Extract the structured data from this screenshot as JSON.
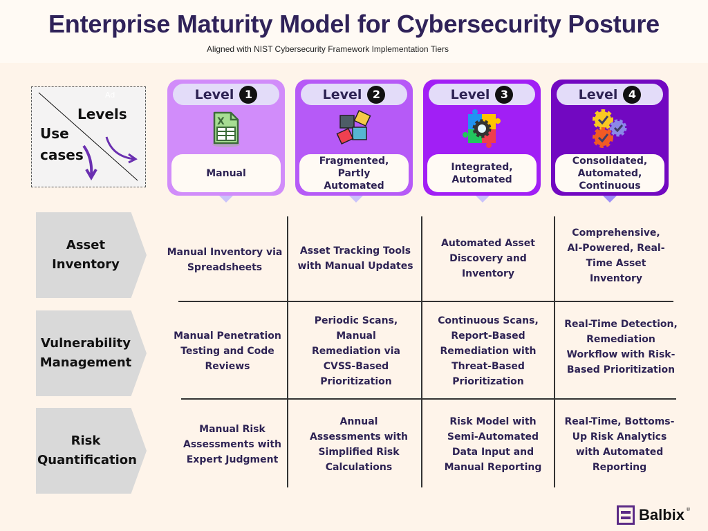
{
  "header": {
    "title": "Enterprise Maturity Model for Cybersecurity Posture",
    "subtitle": "Aligned with NIST Cybersecurity Framework Implementation Tiers"
  },
  "legend": {
    "levels_label": "Levels",
    "use_cases_line1": "Use",
    "use_cases_line2": "cases",
    "watermark": "Ad"
  },
  "levels": [
    {
      "word": "Level",
      "number": "1",
      "description": "Manual",
      "icon": "spreadsheet-icon",
      "color": "#d18cfa"
    },
    {
      "word": "Level",
      "number": "2",
      "description": "Fragmented, Partly Automated",
      "icon": "puzzle-pieces-icon",
      "color": "#b65af7"
    },
    {
      "word": "Level",
      "number": "3",
      "description": "Integrated, Automated",
      "icon": "puzzle-gear-icon",
      "color": "#a11ff5"
    },
    {
      "word": "Level",
      "number": "4",
      "description": "Consolidated, Automated, Continuous",
      "icon": "gears-check-icon",
      "color": "#7208c1"
    }
  ],
  "rows": [
    {
      "use_case": "Asset Inventory",
      "cells": [
        "Manual Inventory via Spreadsheets",
        "Asset Tracking Tools with Manual Updates",
        "Automated Asset Discovery and Inventory",
        "Comprehensive, AI-Powered, Real-Time Asset Inventory"
      ]
    },
    {
      "use_case": "Vulnerability Management",
      "cells": [
        "Manual Penetration Testing and Code Reviews",
        "Periodic Scans, Manual Remediation via CVSS-Based Prioritization",
        "Continuous Scans, Report-Based Remediation with Threat-Based Prioritization",
        "Real-Time Detection, Remediation Workflow with Risk-Based Prioritization"
      ]
    },
    {
      "use_case": "Risk Quantification",
      "cells": [
        "Manual Risk Assessments with Expert Judgment",
        "Annual Assessments with Simplified Risk Calculations",
        "Risk Model with Semi-Automated Data Input and Manual Reporting",
        "Real-Time, Bottoms-Up Risk Analytics with Automated Reporting"
      ]
    }
  ],
  "brand": {
    "name": "Balbix",
    "registered": "®",
    "color": "#5b2a86"
  }
}
